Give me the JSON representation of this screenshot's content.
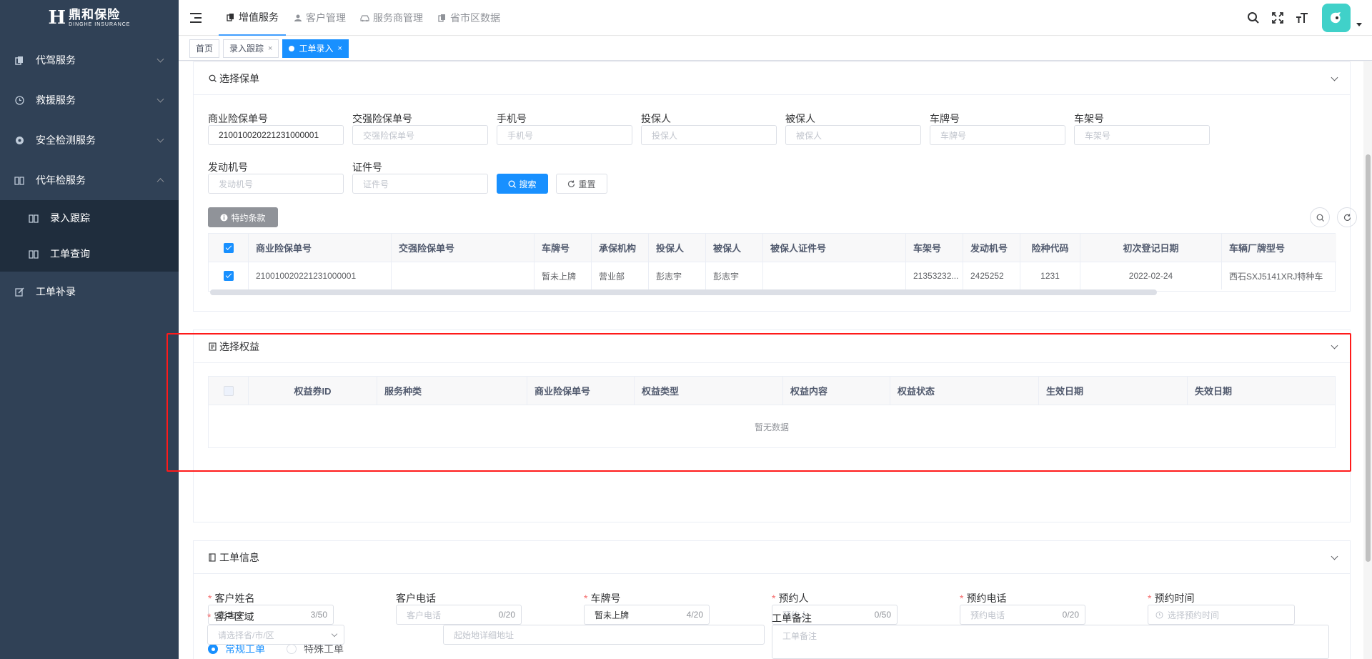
{
  "logo": {
    "mark": "H",
    "cn": "鼎和保险",
    "en": "DINGHE INSURANCE"
  },
  "sidebar": {
    "items": [
      {
        "label": "代驾服务"
      },
      {
        "label": "救援服务"
      },
      {
        "label": "安全检测服务"
      },
      {
        "label": "代年检服务"
      }
    ],
    "sub_items": [
      {
        "label": "录入跟踪"
      },
      {
        "label": "工单查询"
      }
    ],
    "last_item": {
      "label": "工单补录"
    }
  },
  "topnav": {
    "tabs": [
      {
        "label": "增值服务"
      },
      {
        "label": "客户管理"
      },
      {
        "label": "服务商管理"
      },
      {
        "label": "省市区数据"
      }
    ]
  },
  "tagsview": {
    "tags": [
      {
        "label": "首页"
      },
      {
        "label": "录入跟踪"
      },
      {
        "label": "工单录入"
      }
    ],
    "close": "×"
  },
  "policy_section": {
    "title": "选择保单",
    "fields": {
      "commercial_policy": {
        "label": "商业险保单号",
        "value": "210010020221231000001"
      },
      "compulsory_policy": {
        "label": "交强险保单号",
        "placeholder": "交强险保单号"
      },
      "phone": {
        "label": "手机号",
        "placeholder": "手机号"
      },
      "applicant": {
        "label": "投保人",
        "placeholder": "投保人"
      },
      "insured": {
        "label": "被保人",
        "placeholder": "被保人"
      },
      "plate": {
        "label": "车牌号",
        "placeholder": "车牌号"
      },
      "vin": {
        "label": "车架号",
        "placeholder": "车架号"
      },
      "engine": {
        "label": "发动机号",
        "placeholder": "发动机号"
      },
      "cert": {
        "label": "证件号",
        "placeholder": "证件号"
      }
    },
    "search_label": "搜索",
    "reset_label": "重置",
    "special_terms_label": "特约条款",
    "table": {
      "headers": [
        "商业险保单号",
        "交强险保单号",
        "车牌号",
        "承保机构",
        "投保人",
        "被保人",
        "被保人证件号",
        "车架号",
        "发动机号",
        "险种代码",
        "初次登记日期",
        "车辆厂牌型号"
      ],
      "rows": [
        [
          "210010020221231000001",
          "",
          "暂未上牌",
          "营业部",
          "彭志宇",
          "彭志宇",
          "",
          "21353232...",
          "2425252",
          "1231",
          "2022-02-24",
          "西石SXJ5141XRJ特种车"
        ]
      ]
    }
  },
  "benefit_section": {
    "title": "选择权益",
    "table": {
      "headers": [
        "权益券ID",
        "服务种类",
        "商业险保单号",
        "权益类型",
        "权益内容",
        "权益状态",
        "生效日期",
        "失效日期"
      ],
      "empty_text": "暂无数据"
    }
  },
  "order_section": {
    "title": "工单信息",
    "fields": {
      "customer_name": {
        "label": "客户姓名",
        "value": "彭志宇",
        "count": "3/50"
      },
      "customer_phone": {
        "label": "客户电话",
        "placeholder": "客户电话",
        "count": "0/20"
      },
      "plate": {
        "label": "车牌号",
        "value": "暂未上牌",
        "count": "4/20"
      },
      "booker": {
        "label": "预约人",
        "placeholder": "预约人",
        "count": "0/50"
      },
      "booker_phone": {
        "label": "预约电话",
        "placeholder": "预约电话",
        "count": "0/20"
      },
      "booking_time": {
        "label": "预约时间",
        "placeholder": "选择预约时间"
      },
      "region": {
        "label": "客户区域",
        "placeholder": "请选择省/市/区"
      },
      "address": {
        "placeholder": "起始地详细地址"
      },
      "remark": {
        "label": "工单备注",
        "placeholder": "工单备注"
      }
    },
    "order_types": [
      {
        "label": "常规工单",
        "selected": true
      },
      {
        "label": "特殊工单",
        "selected": false
      }
    ]
  },
  "colors": {
    "sidebar": "#304156",
    "primary": "#1890ff",
    "highlight": "#ff1a1a"
  }
}
